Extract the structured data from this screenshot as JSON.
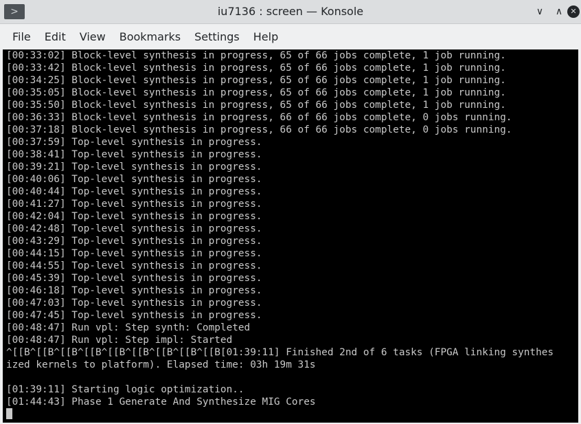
{
  "window": {
    "title": "iu7136 : screen — Konsole",
    "icon": "terminal-icon",
    "buttons": {
      "minimize": "∨",
      "maximize": "∧",
      "close": "✕"
    }
  },
  "menubar": {
    "items": [
      "File",
      "Edit",
      "View",
      "Bookmarks",
      "Settings",
      "Help"
    ]
  },
  "terminal": {
    "colors": {
      "background": "#000000",
      "foreground": "#c9c9c9"
    },
    "lines": [
      "[00:33:02] Block-level synthesis in progress, 65 of 66 jobs complete, 1 job running.",
      "[00:33:42] Block-level synthesis in progress, 65 of 66 jobs complete, 1 job running.",
      "[00:34:25] Block-level synthesis in progress, 65 of 66 jobs complete, 1 job running.",
      "[00:35:05] Block-level synthesis in progress, 65 of 66 jobs complete, 1 job running.",
      "[00:35:50] Block-level synthesis in progress, 65 of 66 jobs complete, 1 job running.",
      "[00:36:33] Block-level synthesis in progress, 66 of 66 jobs complete, 0 jobs running.",
      "[00:37:18] Block-level synthesis in progress, 66 of 66 jobs complete, 0 jobs running.",
      "[00:37:59] Top-level synthesis in progress.",
      "[00:38:41] Top-level synthesis in progress.",
      "[00:39:21] Top-level synthesis in progress.",
      "[00:40:06] Top-level synthesis in progress.",
      "[00:40:44] Top-level synthesis in progress.",
      "[00:41:27] Top-level synthesis in progress.",
      "[00:42:04] Top-level synthesis in progress.",
      "[00:42:48] Top-level synthesis in progress.",
      "[00:43:29] Top-level synthesis in progress.",
      "[00:44:15] Top-level synthesis in progress.",
      "[00:44:55] Top-level synthesis in progress.",
      "[00:45:39] Top-level synthesis in progress.",
      "[00:46:18] Top-level synthesis in progress.",
      "[00:47:03] Top-level synthesis in progress.",
      "[00:47:45] Top-level synthesis in progress.",
      "[00:48:47] Run vpl: Step synth: Completed",
      "[00:48:47] Run vpl: Step impl: Started",
      "^[[B^[[B^[[B^[[B^[[B^[[B^[[B^[[B^[[B[01:39:11] Finished 2nd of 6 tasks (FPGA linking synthes",
      "ized kernels to platform). Elapsed time: 03h 19m 31s",
      "",
      "[01:39:11] Starting logic optimization..",
      "[01:44:43] Phase 1 Generate And Synthesize MIG Cores"
    ]
  }
}
